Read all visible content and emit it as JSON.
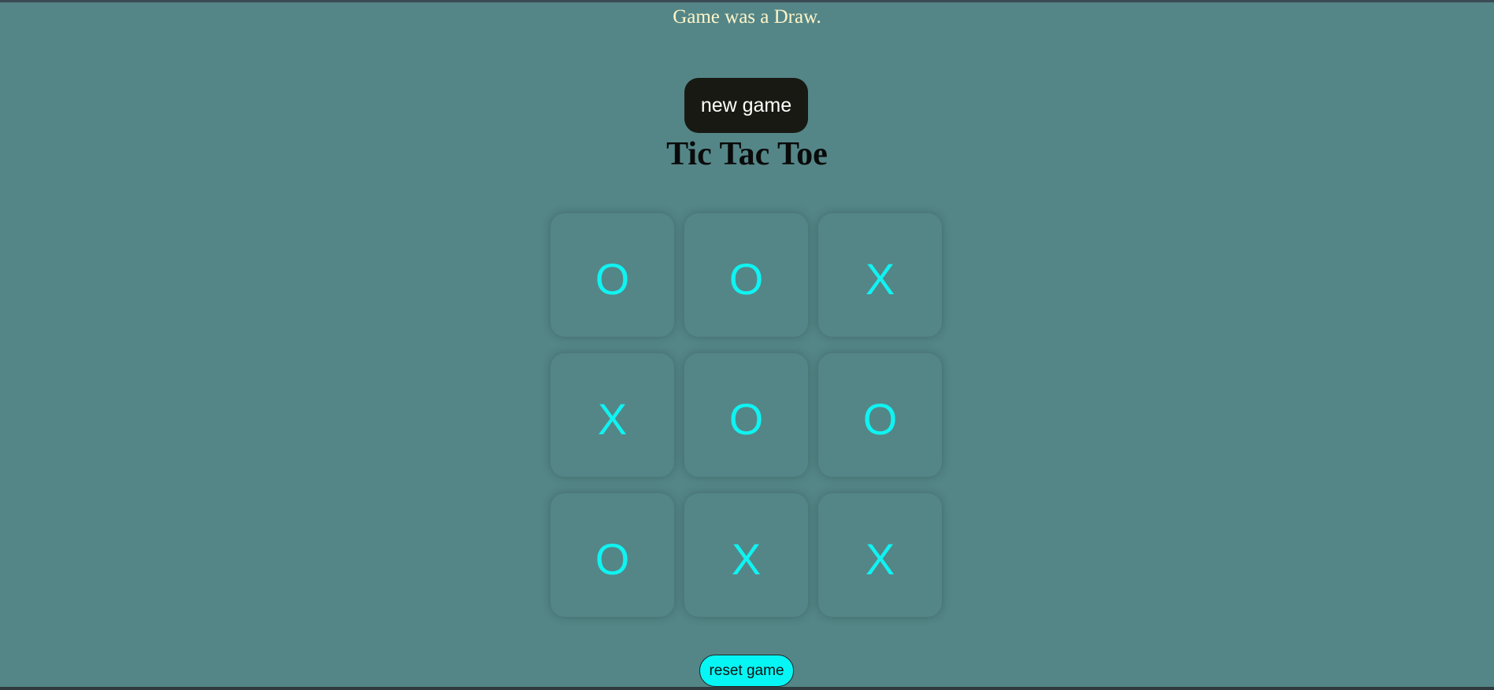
{
  "status": {
    "message": "Game was a Draw."
  },
  "controls": {
    "new_game_label": "new game",
    "reset_game_label": "reset game"
  },
  "title": "Tic Tac Toe",
  "board": {
    "cells": [
      "O",
      "O",
      "X",
      "X",
      "O",
      "O",
      "O",
      "X",
      "X"
    ]
  },
  "colors": {
    "background": "#548687",
    "mark": "#0ff3f2",
    "status_text": "#fff5c8",
    "new_game_bg": "#191913",
    "reset_bg": "#06f6f5"
  }
}
